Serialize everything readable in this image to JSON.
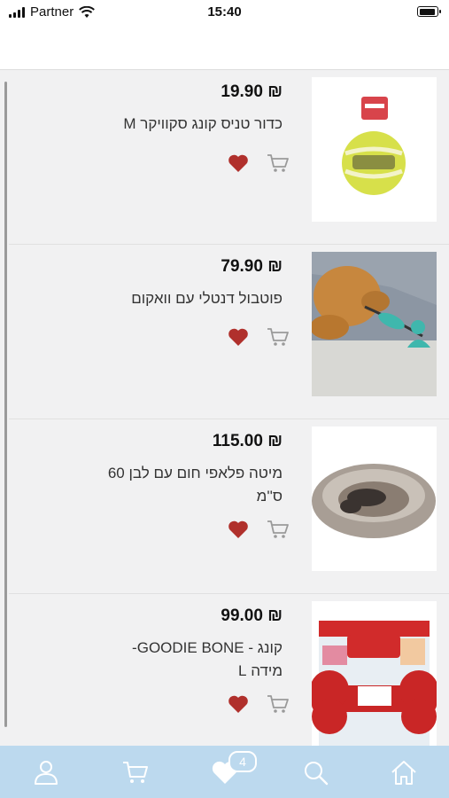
{
  "status_bar": {
    "carrier": "Partner",
    "time": "15:40"
  },
  "products": [
    {
      "price": "19.90 ₪",
      "title": "כדור טניס קונג סקוויקר M"
    },
    {
      "price": "79.90 ₪",
      "title": "פוטבול דנטלי עם וואקום"
    },
    {
      "price": "115.00 ₪",
      "title": "מיטה פלאפי חום עם לבן 60 ס''מ"
    },
    {
      "price": "99.00 ₪",
      "title": "קונג - GOODIE BONE- מידה L"
    }
  ],
  "tabbar": {
    "favorites_count": "4"
  },
  "colors": {
    "heart": "#b0302c",
    "tabbar": "#bcd9ee",
    "cart_icon": "#9a9a9a"
  }
}
